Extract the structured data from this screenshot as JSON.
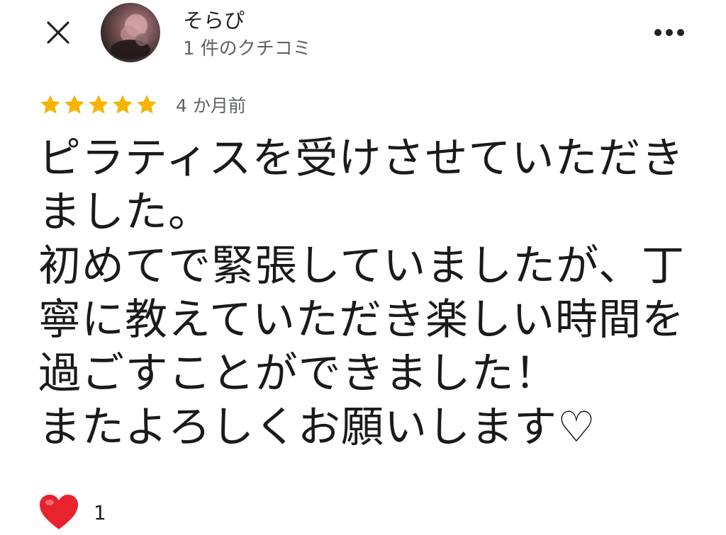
{
  "header": {
    "author_name": "そらぴ",
    "author_meta": "1 件のクチコミ"
  },
  "icons": {
    "close": "close-icon",
    "more": "more-horizontal-icon",
    "star": "star-icon",
    "heart": "heart-icon"
  },
  "colors": {
    "star": "#f6b400",
    "heart": "#e8232e",
    "text": "#1a1a1a",
    "meta": "#5f6368"
  },
  "review": {
    "rating": 5,
    "max_rating": 5,
    "date": "4 か月前",
    "text": "ピラティスを受けさせていただき\nました。\n初めてで緊張していましたが、丁\n寧に教えていただき楽しい時間を\n過ごすことができました！\nまたよろしくお願いします♡"
  },
  "reactions": {
    "count": "1"
  }
}
